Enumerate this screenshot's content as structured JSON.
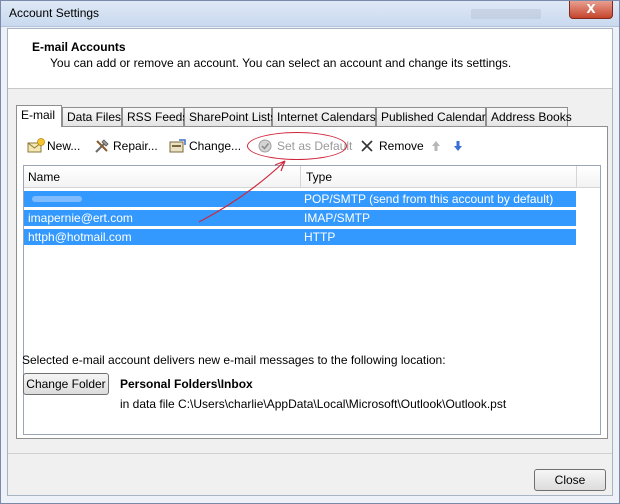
{
  "window": {
    "title": "Account Settings",
    "close_glyph": "X"
  },
  "header": {
    "title": "E-mail Accounts",
    "description": "You can add or remove an account. You can select an account and change its settings."
  },
  "tabs": [
    {
      "label": "E-mail",
      "active": true
    },
    {
      "label": "Data Files",
      "active": false
    },
    {
      "label": "RSS Feeds",
      "active": false
    },
    {
      "label": "SharePoint Lists",
      "active": false
    },
    {
      "label": "Internet Calendars",
      "active": false
    },
    {
      "label": "Published Calendars",
      "active": false
    },
    {
      "label": "Address Books",
      "active": false
    }
  ],
  "toolbar": {
    "new_label": "New...",
    "repair_label": "Repair...",
    "change_label": "Change...",
    "set_default_label": "Set as Default",
    "remove_label": "Remove",
    "icons": {
      "new": "new-account-icon",
      "repair": "repair-tools-icon",
      "change": "change-settings-icon",
      "set_default": "check-circle-icon",
      "remove": "x-icon",
      "up": "move-up-icon",
      "down": "move-down-icon"
    }
  },
  "accounts": {
    "columns": {
      "name": "Name",
      "type": "Type"
    },
    "rows": [
      {
        "name": "",
        "type": "POP/SMTP (send from this account by default)",
        "name_obscured": true
      },
      {
        "name": "imapernie@ert.com",
        "type": "IMAP/SMTP"
      },
      {
        "name": "httph@hotmail.com",
        "type": "HTTP"
      }
    ]
  },
  "delivery": {
    "label": "Selected e-mail account delivers new e-mail messages to the following location:",
    "change_folder_label": "Change Folder",
    "folder": "Personal Folders\\Inbox",
    "data_file": "in data file C:\\Users\\charlie\\AppData\\Local\\Microsoft\\Outlook\\Outlook.pst"
  },
  "footer": {
    "close_label": "Close"
  },
  "colors": {
    "selection": "#3399ff",
    "annotation": "#d0263b"
  }
}
